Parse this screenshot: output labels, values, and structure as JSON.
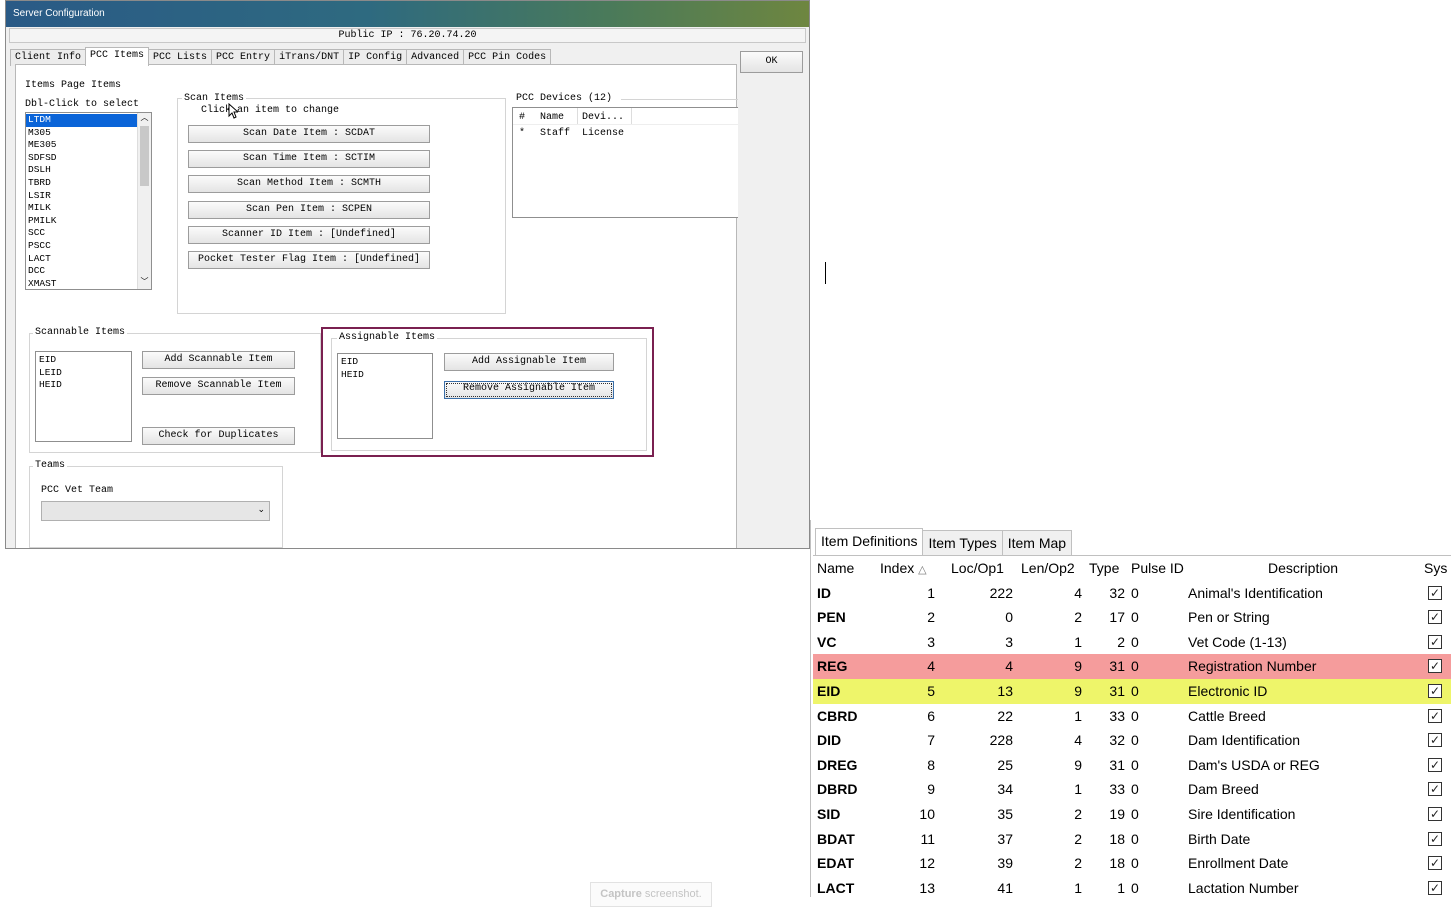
{
  "window": {
    "title": "Server Configuration",
    "public_ip": "Public IP : 76.20.74.20",
    "ok_label": "OK",
    "tabs": [
      "Client Info",
      "PCC Items",
      "PCC Lists",
      "PCC Entry",
      "iTrans/DNT",
      "IP Config",
      "Advanced",
      "PCC Pin Codes"
    ],
    "active_tab": "PCC Items"
  },
  "items_page": {
    "heading": "Items Page Items",
    "dbl_click": "Dbl-Click to select",
    "list": [
      "LTDM",
      "M305",
      "ME305",
      "SDFSD",
      "DSLH",
      "TBRD",
      "LSIR",
      "MILK",
      "PMILK",
      "SCC",
      "PSCC",
      "LACT",
      "DCC",
      "XMAST"
    ],
    "selected": "LTDM"
  },
  "scan_items": {
    "legend": "Scan Items",
    "hint": "Click an item to change",
    "buttons": [
      "Scan Date Item : SCDAT",
      "Scan Time Item : SCTIM",
      "Scan Method Item : SCMTH",
      "Scan Pen Item : SCPEN",
      "Scanner ID Item : [Undefined]",
      "Pocket Tester Flag Item : [Undefined]"
    ]
  },
  "pcc_devices": {
    "legend": "PCC Devices (12)",
    "columns": [
      "#",
      "Name",
      "Devi..."
    ],
    "rows": [
      [
        "*",
        "Staff",
        "License"
      ]
    ]
  },
  "scannable": {
    "legend": "Scannable Items",
    "items": [
      "EID",
      "LEID",
      "HEID"
    ],
    "add": "Add Scannable Item",
    "remove": "Remove Scannable Item",
    "check": "Check for Duplicates"
  },
  "assignable": {
    "legend": "Assignable Items",
    "items": [
      "EID",
      "HEID"
    ],
    "add": "Add Assignable Item",
    "remove": "Remove Assignable Item",
    "highlight_color": "#7a2050"
  },
  "teams": {
    "legend": "Teams",
    "label": "PCC Vet Team",
    "value": ""
  },
  "item_defs": {
    "tabs": [
      "Item Definitions",
      "Item Types",
      "Item Map"
    ],
    "active_tab": "Item Definitions",
    "columns": [
      "Name",
      "Index",
      "Loc/Op1",
      "Len/Op2",
      "Type",
      "Pulse ID",
      "Description",
      "Sys"
    ],
    "sort_indicator": "△",
    "rows": [
      {
        "name": "ID",
        "index": "1",
        "loc": "222",
        "len": "4",
        "type": "32",
        "pulse": "0",
        "desc": "Animal's Identification",
        "sys": true,
        "highlight": ""
      },
      {
        "name": "PEN",
        "index": "2",
        "loc": "0",
        "len": "2",
        "type": "17",
        "pulse": "0",
        "desc": "Pen or String",
        "sys": true,
        "highlight": ""
      },
      {
        "name": "VC",
        "index": "3",
        "loc": "3",
        "len": "1",
        "type": "2",
        "pulse": "0",
        "desc": "Vet Code (1-13)",
        "sys": true,
        "highlight": ""
      },
      {
        "name": "REG",
        "index": "4",
        "loc": "4",
        "len": "9",
        "type": "31",
        "pulse": "0",
        "desc": "Registration Number",
        "sys": true,
        "highlight": "#f59c9c"
      },
      {
        "name": "EID",
        "index": "5",
        "loc": "13",
        "len": "9",
        "type": "31",
        "pulse": "0",
        "desc": "Electronic ID",
        "sys": true,
        "highlight": "#eef56a"
      },
      {
        "name": "CBRD",
        "index": "6",
        "loc": "22",
        "len": "1",
        "type": "33",
        "pulse": "0",
        "desc": "Cattle Breed",
        "sys": true,
        "highlight": ""
      },
      {
        "name": "DID",
        "index": "7",
        "loc": "228",
        "len": "4",
        "type": "32",
        "pulse": "0",
        "desc": "Dam Identification",
        "sys": true,
        "highlight": ""
      },
      {
        "name": "DREG",
        "index": "8",
        "loc": "25",
        "len": "9",
        "type": "31",
        "pulse": "0",
        "desc": "Dam's USDA or REG",
        "sys": true,
        "highlight": ""
      },
      {
        "name": "DBRD",
        "index": "9",
        "loc": "34",
        "len": "1",
        "type": "33",
        "pulse": "0",
        "desc": "Dam Breed",
        "sys": true,
        "highlight": ""
      },
      {
        "name": "SID",
        "index": "10",
        "loc": "35",
        "len": "2",
        "type": "19",
        "pulse": "0",
        "desc": "Sire Identification",
        "sys": true,
        "highlight": ""
      },
      {
        "name": "BDAT",
        "index": "11",
        "loc": "37",
        "len": "2",
        "type": "18",
        "pulse": "0",
        "desc": "Birth Date",
        "sys": true,
        "highlight": ""
      },
      {
        "name": "EDAT",
        "index": "12",
        "loc": "39",
        "len": "2",
        "type": "18",
        "pulse": "0",
        "desc": "Enrollment Date",
        "sys": true,
        "highlight": ""
      },
      {
        "name": "LACT",
        "index": "13",
        "loc": "41",
        "len": "1",
        "type": "1",
        "pulse": "0",
        "desc": "Lactation Number",
        "sys": true,
        "highlight": ""
      }
    ]
  },
  "capture": {
    "bold": "Capture",
    "rest": " screenshot."
  }
}
